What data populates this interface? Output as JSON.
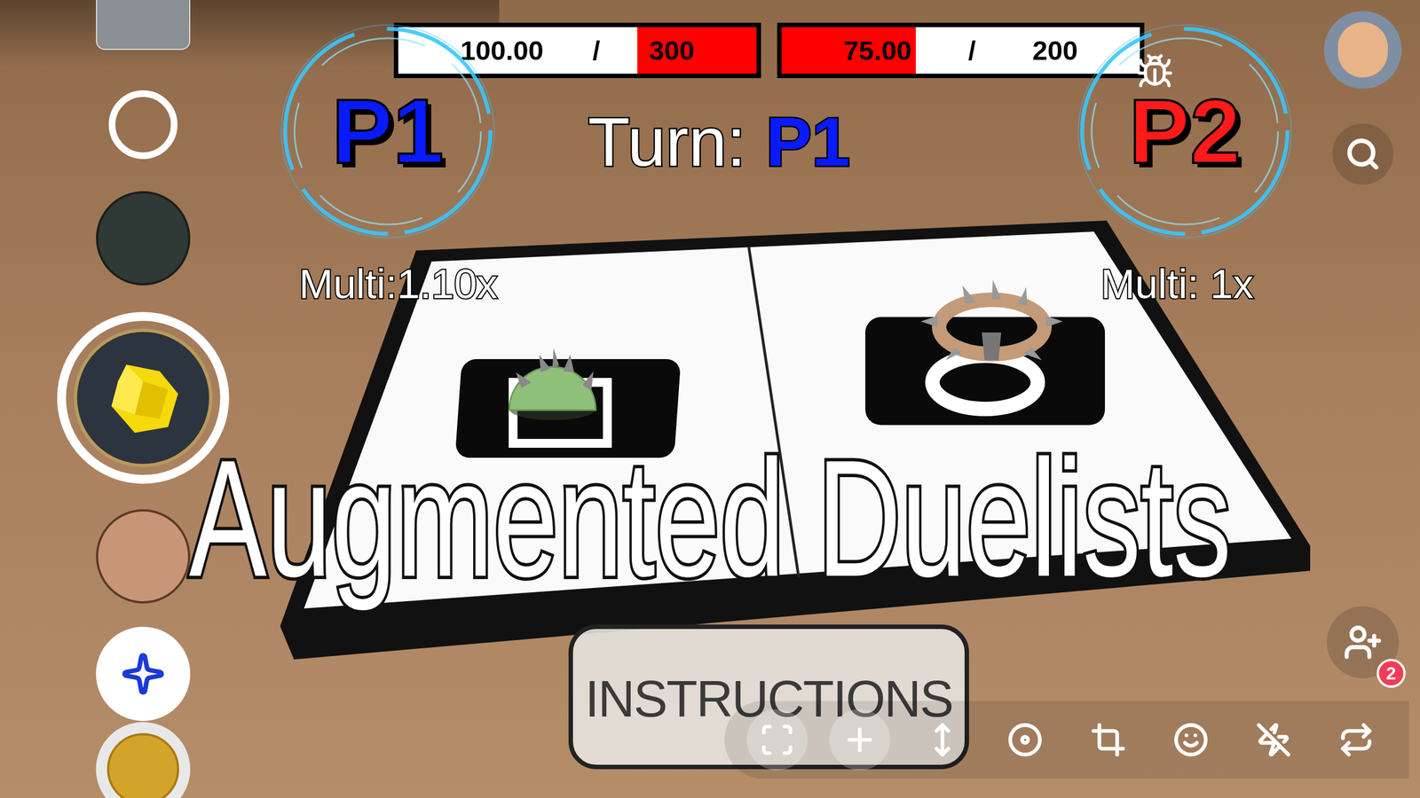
{
  "hud": {
    "players": [
      {
        "name": "P1",
        "color": "#0a1aff",
        "health": "100.00",
        "separator": "/",
        "max_health": "300",
        "level": 0.333,
        "fill_from": "right",
        "multiplier": "Multi:1.10x"
      },
      {
        "name": "P2",
        "color": "#ff1a1a",
        "health": "75.00",
        "separator": "/",
        "max_health": "200",
        "level": 0.375,
        "fill_from": "left",
        "multiplier": "Multi: 1x"
      }
    ],
    "turn": {
      "label": "Turn:",
      "player": "P1",
      "color": "#0a1aff"
    }
  },
  "title": "Augmented Duelists",
  "instructions_button": "INSTRUCTIONS",
  "snapchat": {
    "add_friends_badge": "2",
    "lens_carousel": [
      {
        "kind": "preview",
        "selected": false
      },
      {
        "kind": "capture",
        "selected": false
      },
      {
        "kind": "thumbnail",
        "selected": false
      },
      {
        "kind": "lens",
        "selected": true
      },
      {
        "kind": "avatar",
        "selected": false
      },
      {
        "kind": "sparkle",
        "selected": false
      },
      {
        "kind": "coin",
        "selected": false
      }
    ]
  }
}
